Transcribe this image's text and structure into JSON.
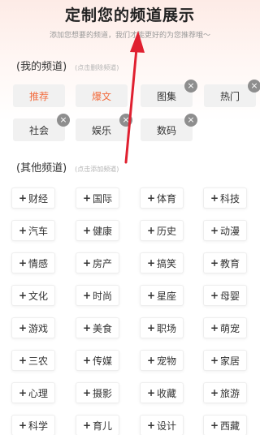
{
  "header": {
    "title": "定制您的频道展示",
    "subtitle": "添加您想要的频道，我们才能更好的为您推荐哦～"
  },
  "my_channels": {
    "name": "(我的频道)",
    "hint": "(点击删除频道)",
    "items": [
      "推荐",
      "爆文",
      "图集",
      "热门",
      "社会",
      "娱乐",
      "数码"
    ],
    "fixed": [
      true,
      true,
      false,
      false,
      false,
      false,
      false
    ]
  },
  "other_channels": {
    "name": "(其他频道)",
    "hint": "(点击添加频道)",
    "items": [
      "财经",
      "国际",
      "体育",
      "科技",
      "汽车",
      "健康",
      "历史",
      "动漫",
      "情感",
      "房产",
      "搞笑",
      "教育",
      "文化",
      "时尚",
      "星座",
      "母婴",
      "游戏",
      "美食",
      "职场",
      "萌宠",
      "三农",
      "传媒",
      "宠物",
      "家居",
      "心理",
      "摄影",
      "收藏",
      "旅游",
      "科学",
      "育儿",
      "设计",
      "西藏"
    ]
  },
  "icons": {
    "delete": "close-circle-icon",
    "add": "plus-icon"
  },
  "colors": {
    "accent": "#f26c3e",
    "arrow": "#e02030",
    "chip_bg": "#f1f1f1"
  }
}
